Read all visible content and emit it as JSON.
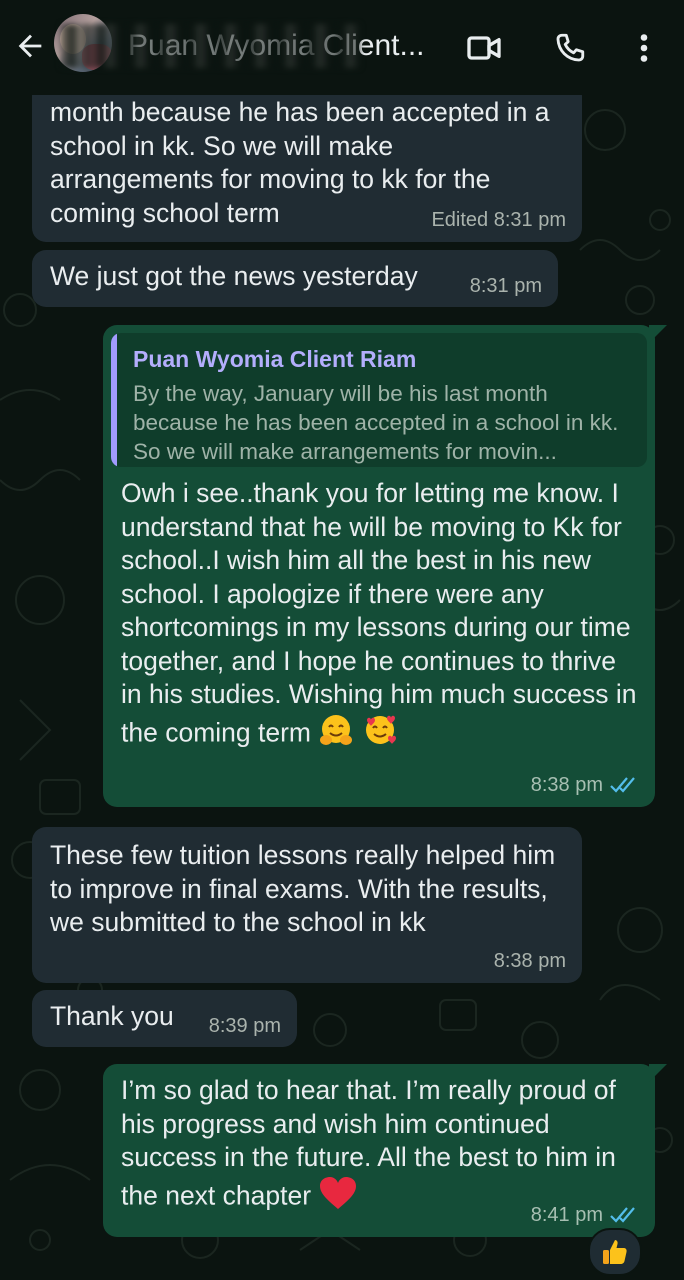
{
  "header": {
    "contact_name": "Puan Wyomia Client...",
    "back_icon": "arrow-left-icon",
    "video_icon": "video-camera-icon",
    "call_icon": "phone-icon",
    "menu_icon": "kebab-menu-icon"
  },
  "colors": {
    "background": "#0b1410",
    "incoming_bubble": "#202c33",
    "outgoing_bubble": "#144d37",
    "read_tick": "#53bdeb",
    "quote_accent": "#a29bfe"
  },
  "messages": [
    {
      "direction": "in",
      "text": "month because he has been accepted in a school in kk. So we will make arrangements for moving to kk for the coming school term",
      "time": "Edited 8:31 pm"
    },
    {
      "direction": "in",
      "text": "We just got the news yesterday",
      "time": "8:31 pm"
    },
    {
      "direction": "out",
      "quote": {
        "author": "Puan Wyomia Client Riam",
        "text": "By the way, January will be his last month because he has been accepted in a school in kk. So we will make arrangements for movin..."
      },
      "text": "Owh i see..thank you for letting me know. I understand that he will be moving to Kk for school..I wish him all the best in his new school. I apologize if there were any shortcomings in my lessons during our time together, and I hope he continues to thrive in his studies. Wishing him much success in the coming term",
      "emojis": [
        "hugging-face-emoji",
        "smiling-face-with-hearts-emoji"
      ],
      "time": "8:38 pm",
      "status": "read"
    },
    {
      "direction": "in",
      "text": "These few tuition lessons really helped him to improve in final exams. With the results, we submitted to the school in kk",
      "time": "8:38 pm"
    },
    {
      "direction": "in",
      "text": "Thank you",
      "time": "8:39 pm"
    },
    {
      "direction": "out",
      "text": "I’m so glad to hear that. I’m really proud of his progress and wish him continued success in the future. All the best to him in the next chapter",
      "emojis": [
        "red-heart-emoji"
      ],
      "time": "8:41 pm",
      "status": "read",
      "reaction": "thumbs-up-emoji"
    }
  ]
}
